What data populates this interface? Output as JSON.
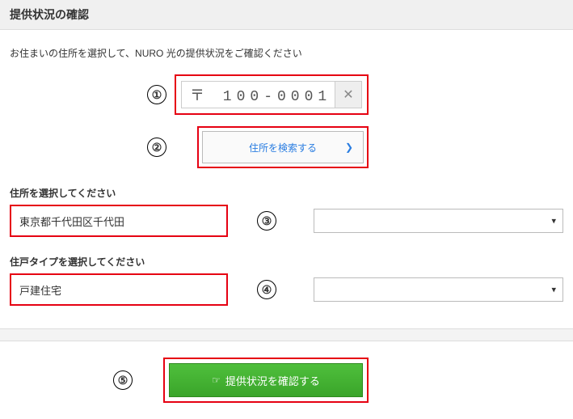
{
  "header": {
    "title": "提供状況の確認"
  },
  "instruction": "お住まいの住所を選択して、NURO 光の提供状況をご確認ください",
  "annotations": {
    "n1": "①",
    "n2": "②",
    "n3": "③",
    "n4": "④",
    "n5": "⑤"
  },
  "postal": {
    "prefix": "〒",
    "value": "100-0001",
    "clear_icon": "✕"
  },
  "search_button": {
    "label": "住所を検索する",
    "chevron": "❯"
  },
  "address": {
    "section_label": "住所を選択してください",
    "value": "東京都千代田区千代田"
  },
  "unit_type": {
    "section_label": "住戸タイプを選択してください",
    "value": "戸建住宅"
  },
  "submit": {
    "label": "提供状況を確認する",
    "icon": "☞"
  }
}
